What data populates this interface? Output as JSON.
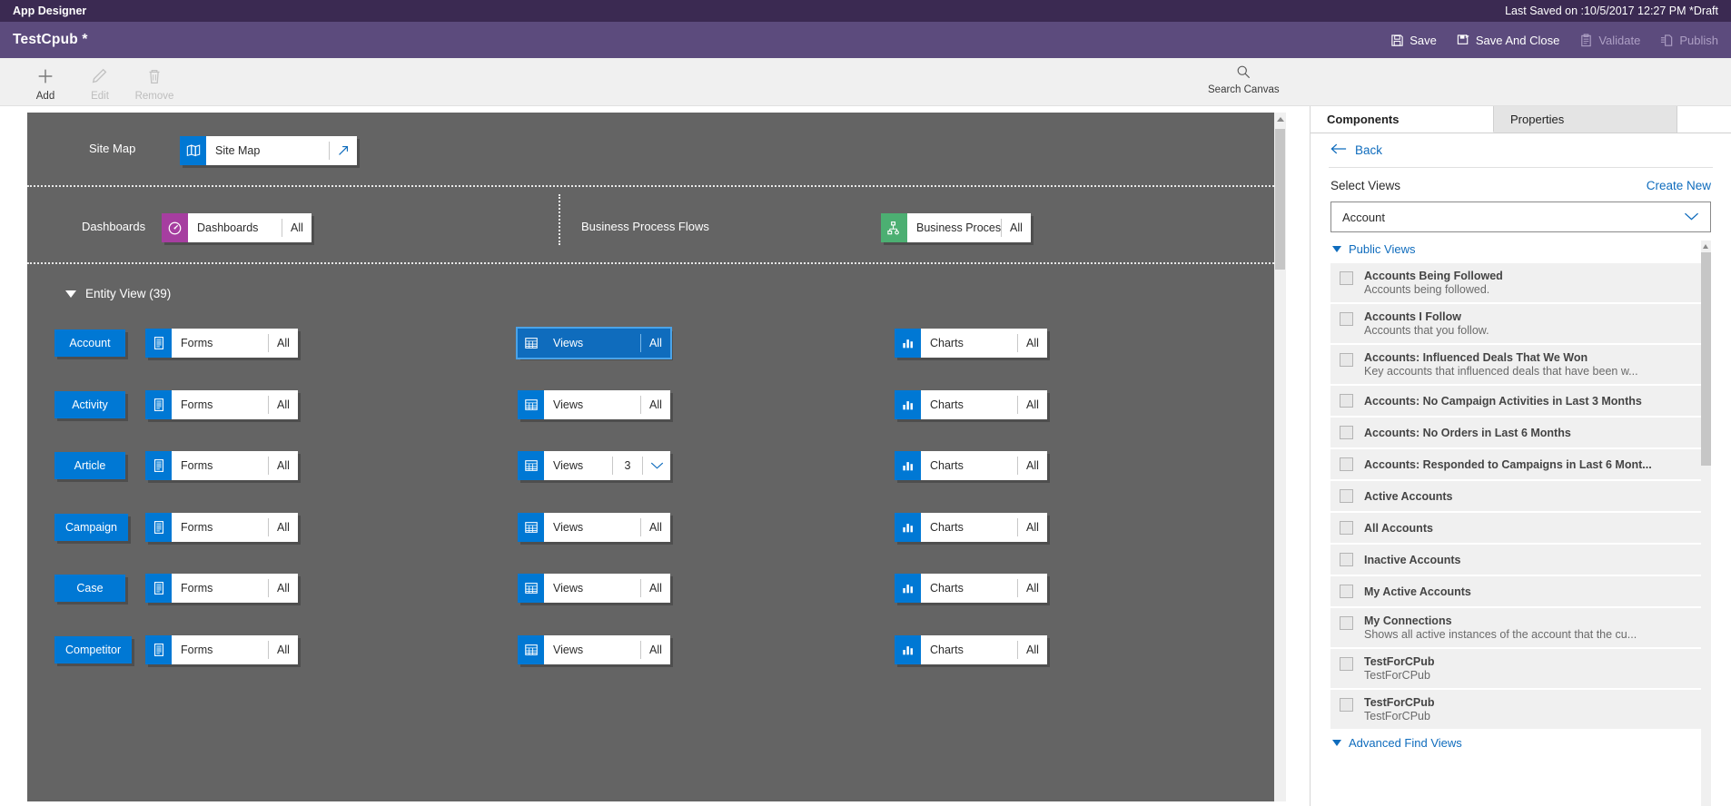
{
  "titlebar": {
    "app_title": "App Designer",
    "last_saved": "Last Saved on :10/5/2017 12:27 PM *Draft"
  },
  "appbar": {
    "app_name": "TestCpub *",
    "commands": [
      {
        "label": "Save",
        "icon": "save-icon",
        "enabled": true
      },
      {
        "label": "Save And Close",
        "icon": "save-and-close-icon",
        "enabled": true
      },
      {
        "label": "Validate",
        "icon": "validate-icon",
        "enabled": false
      },
      {
        "label": "Publish",
        "icon": "publish-icon",
        "enabled": false
      }
    ]
  },
  "ribbon": {
    "buttons": [
      {
        "label": "Add",
        "icon": "plus-icon",
        "enabled": true
      },
      {
        "label": "Edit",
        "icon": "pencil-icon",
        "enabled": false
      },
      {
        "label": "Remove",
        "icon": "trash-icon",
        "enabled": false
      }
    ],
    "search": {
      "label": "Search Canvas",
      "icon": "search-icon"
    }
  },
  "canvas": {
    "sitemap_row": {
      "label": "Site Map",
      "tile": {
        "label": "Site Map",
        "icon": "sitemap-icon",
        "icon_color": "#0078d4",
        "action": "open-arrow"
      }
    },
    "dashboards_row": {
      "label": "Dashboards",
      "tile": {
        "label": "Dashboards",
        "count": "All",
        "icon": "dashboard-gauge-icon",
        "icon_color": "#a63ea0"
      }
    },
    "bpf_row": {
      "label": "Business Process Flows",
      "tile": {
        "label": "Business Proces...",
        "count": "All",
        "icon": "process-flow-icon",
        "icon_color": "#4caf72"
      }
    },
    "entity_section": {
      "label": "Entity View (39)"
    },
    "column_tiles": {
      "forms": {
        "label": "Forms",
        "icon": "forms-icon"
      },
      "views": {
        "label": "Views",
        "icon": "views-grid-icon"
      },
      "charts": {
        "label": "Charts",
        "icon": "charts-bar-icon"
      }
    },
    "entities": [
      {
        "name": "Account",
        "forms_count": "All",
        "views_count": "All",
        "views_selected": true,
        "views_has_chevron": false,
        "charts_count": "All"
      },
      {
        "name": "Activity",
        "forms_count": "All",
        "views_count": "All",
        "views_selected": false,
        "views_has_chevron": false,
        "charts_count": "All"
      },
      {
        "name": "Article",
        "forms_count": "All",
        "views_count": "3",
        "views_selected": false,
        "views_has_chevron": true,
        "charts_count": "All"
      },
      {
        "name": "Campaign",
        "forms_count": "All",
        "views_count": "All",
        "views_selected": false,
        "views_has_chevron": false,
        "charts_count": "All"
      },
      {
        "name": "Case",
        "forms_count": "All",
        "views_count": "All",
        "views_selected": false,
        "views_has_chevron": false,
        "charts_count": "All"
      },
      {
        "name": "Competitor",
        "forms_count": "All",
        "views_count": "All",
        "views_selected": false,
        "views_has_chevron": false,
        "charts_count": "All"
      }
    ]
  },
  "panel": {
    "tabs": [
      {
        "label": "Components",
        "active": true
      },
      {
        "label": "Properties",
        "active": false
      }
    ],
    "back_label": "Back",
    "section_label": "Select Views",
    "create_new_label": "Create New",
    "entity_select_value": "Account",
    "groups": [
      {
        "label": "Public Views",
        "expanded": true
      },
      {
        "label": "Advanced Find Views",
        "expanded": true
      }
    ],
    "views": [
      {
        "name": "Accounts Being Followed",
        "desc": "Accounts being followed.",
        "checked": false
      },
      {
        "name": "Accounts I Follow",
        "desc": "Accounts that you follow.",
        "checked": false
      },
      {
        "name": "Accounts: Influenced Deals That We Won",
        "desc": "Key accounts that influenced deals that have been w...",
        "checked": false
      },
      {
        "name": "Accounts: No Campaign Activities in Last 3 Months",
        "desc": "",
        "checked": false
      },
      {
        "name": "Accounts: No Orders in Last 6 Months",
        "desc": "",
        "checked": false
      },
      {
        "name": "Accounts: Responded to Campaigns in Last 6 Mont...",
        "desc": "",
        "checked": false
      },
      {
        "name": "Active Accounts",
        "desc": "",
        "checked": false
      },
      {
        "name": "All Accounts",
        "desc": "",
        "checked": false
      },
      {
        "name": "Inactive Accounts",
        "desc": "",
        "checked": false
      },
      {
        "name": "My Active Accounts",
        "desc": "",
        "checked": false
      },
      {
        "name": "My Connections",
        "desc": "Shows all active instances of the account that the cu...",
        "checked": false
      },
      {
        "name": "TestForCPub",
        "desc": "TestForCPub",
        "checked": false
      },
      {
        "name": "TestForCPub",
        "desc": "TestForCPub",
        "checked": false
      }
    ]
  },
  "colors": {
    "title_purple": "#3b2a52",
    "app_purple": "#5c4b7d",
    "accent_blue": "#0078d4",
    "link_blue": "#0f6cbd",
    "canvas_gray": "#646464",
    "magenta": "#a63ea0",
    "green": "#4caf72"
  }
}
